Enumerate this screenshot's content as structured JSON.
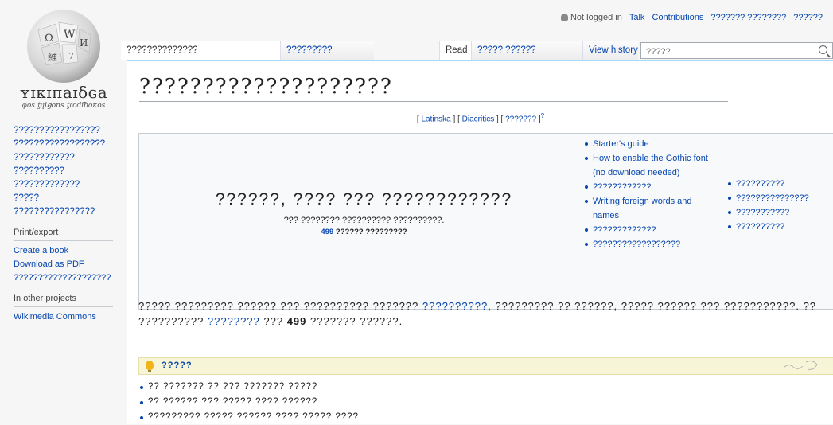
{
  "logo": {
    "wordmark": "ʏɪкɪπaɪδɢa",
    "tagline": "ϕos ƫɥiꞡons ƫɾodiƀoκos",
    "globe_glyphs": [
      "Ω",
      "W",
      "И",
      "維",
      "7"
    ]
  },
  "personal": {
    "status": "Not logged in",
    "talk": "Talk",
    "contributions": "Contributions",
    "create_account": "??????? ????????",
    "log_in": "??????"
  },
  "tabs": {
    "main_page": "??????????????",
    "discussion": "?????????",
    "read": "Read",
    "view_source": "????? ??????",
    "view_history": "View history"
  },
  "search": {
    "placeholder": "?????"
  },
  "sidebar": {
    "nav": [
      "?????????????????",
      "??????????????????",
      "????????????",
      "??????????",
      "?????????????",
      "?????",
      "????????????????"
    ],
    "print_heading": "Print/export",
    "print": [
      "Create a book",
      "Download as PDF",
      "????????????????????"
    ],
    "projects_heading": "In other projects",
    "projects": [
      "Wikimedia Commons"
    ]
  },
  "page": {
    "title": "????????????????????",
    "scripts": {
      "latinska": "Latinska",
      "diacritics": "Diacritics",
      "other": "???????",
      "sup": "?"
    }
  },
  "banner": {
    "welcome": "??????, ???? ??? ????????????",
    "subtitle": "??? ???????? ?????????? ??????????.",
    "article_count_num": "499",
    "article_count_text": "?????? ?????????",
    "list1": [
      "Starter's guide",
      "How to enable the Gothic font (no download needed)",
      "????????????",
      "Writing foreign words and names",
      "?????????????",
      "??????????????????"
    ],
    "list2": [
      "??????????",
      "???????????????",
      "???????????",
      "??????????"
    ]
  },
  "intro": {
    "text1": "????? ????????? ?????? ??? ?????????? ??????? ",
    "link1": "??????????",
    "text2": ", ????????? ?? ??????, ????? ?????? ??? ???????????. ?? ?????????? ",
    "link2": "????????",
    "text3": " ??? ",
    "count": "499",
    "text4": " ??????? ??????."
  },
  "tip": {
    "title": "?????",
    "items": [
      "?? ??????? ?? ??? ??????? ?????",
      "?? ?????? ??? ????? ???? ??????",
      "????????? ????? ?????? ???? ????? ????"
    ]
  }
}
